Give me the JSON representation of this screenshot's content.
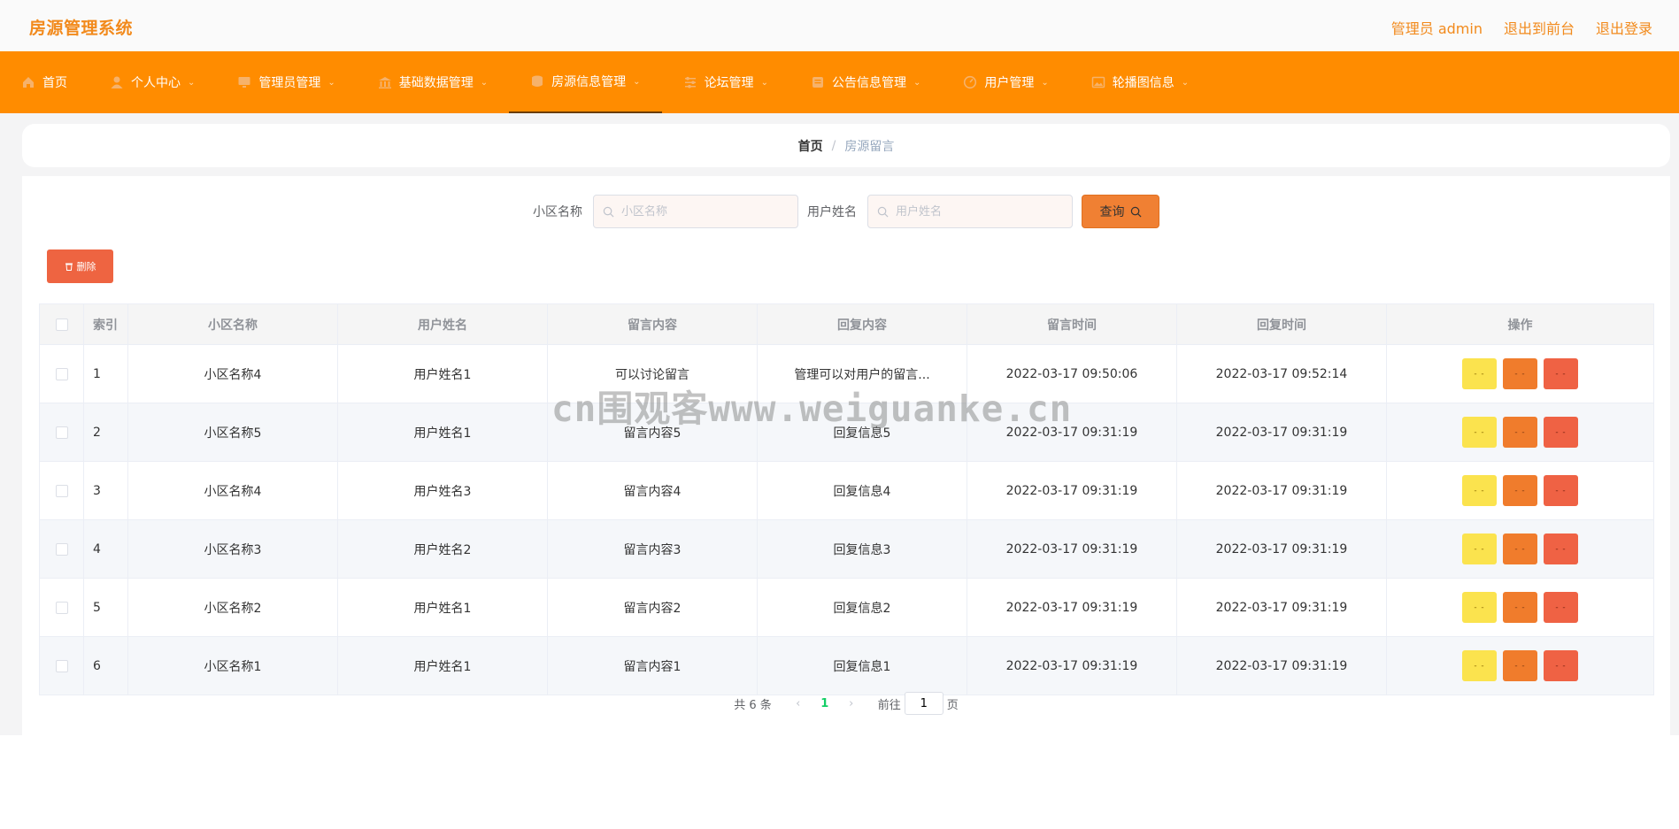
{
  "header": {
    "brand": "房源管理系统",
    "links": [
      "管理员 admin",
      "退出到前台",
      "退出登录"
    ]
  },
  "nav": {
    "items": [
      {
        "label": "首页",
        "icon": "home-icon"
      },
      {
        "label": "个人中心",
        "icon": "user-icon"
      },
      {
        "label": "管理员管理",
        "icon": "monitor-icon"
      },
      {
        "label": "基础数据管理",
        "icon": "bank-icon"
      },
      {
        "label": "房源信息管理",
        "icon": "coin-icon"
      },
      {
        "label": "论坛管理",
        "icon": "sliders-icon"
      },
      {
        "label": "公告信息管理",
        "icon": "notice-icon"
      },
      {
        "label": "用户管理",
        "icon": "gauge-icon"
      },
      {
        "label": "轮播图信息",
        "icon": "picture-icon"
      }
    ],
    "active_index": 4
  },
  "breadcrumb": {
    "home": "首页",
    "separator": "/",
    "current": "房源留言"
  },
  "search": {
    "community_label": "小区名称",
    "community_placeholder": "小区名称",
    "user_label": "用户姓名",
    "user_placeholder": "用户姓名",
    "button": "查询"
  },
  "toolbar": {
    "delete_label": "删除"
  },
  "table": {
    "columns": [
      "索引",
      "小区名称",
      "用户姓名",
      "留言内容",
      "回复内容",
      "留言时间",
      "回复时间",
      "操作"
    ],
    "rows": [
      {
        "index": "1",
        "community": "小区名称4",
        "user": "用户姓名1",
        "message": "可以讨论留言",
        "reply": "管理可以对用户的留言...",
        "msg_time": "2022-03-17 09:50:06",
        "reply_time": "2022-03-17 09:52:14"
      },
      {
        "index": "2",
        "community": "小区名称5",
        "user": "用户姓名1",
        "message": "留言内容5",
        "reply": "回复信息5",
        "msg_time": "2022-03-17 09:31:19",
        "reply_time": "2022-03-17 09:31:19"
      },
      {
        "index": "3",
        "community": "小区名称4",
        "user": "用户姓名3",
        "message": "留言内容4",
        "reply": "回复信息4",
        "msg_time": "2022-03-17 09:31:19",
        "reply_time": "2022-03-17 09:31:19"
      },
      {
        "index": "4",
        "community": "小区名称3",
        "user": "用户姓名2",
        "message": "留言内容3",
        "reply": "回复信息3",
        "msg_time": "2022-03-17 09:31:19",
        "reply_time": "2022-03-17 09:31:19"
      },
      {
        "index": "5",
        "community": "小区名称2",
        "user": "用户姓名1",
        "message": "留言内容2",
        "reply": "回复信息2",
        "msg_time": "2022-03-17 09:31:19",
        "reply_time": "2022-03-17 09:31:19"
      },
      {
        "index": "6",
        "community": "小区名称1",
        "user": "用户姓名1",
        "message": "留言内容1",
        "reply": "回复信息1",
        "msg_time": "2022-03-17 09:31:19",
        "reply_time": "2022-03-17 09:31:19"
      }
    ],
    "action_buttons": [
      "- -",
      "- -",
      "- -"
    ]
  },
  "pagination": {
    "total_text": "共 6 条",
    "current_page": "1",
    "goto_prefix": "前往",
    "goto_value": "1",
    "goto_suffix": "页"
  },
  "watermark": "cn围观客www.weiguanke.cn",
  "colors": {
    "nav_bg": "#ff8c00",
    "brand": "#f28a1c",
    "delete": "#ee6441",
    "search_btn": "#f08033",
    "op_yellow": "#fbe34e",
    "op_orange": "#f07c2c",
    "op_red": "#ef6244",
    "page_active": "#13ce66"
  }
}
